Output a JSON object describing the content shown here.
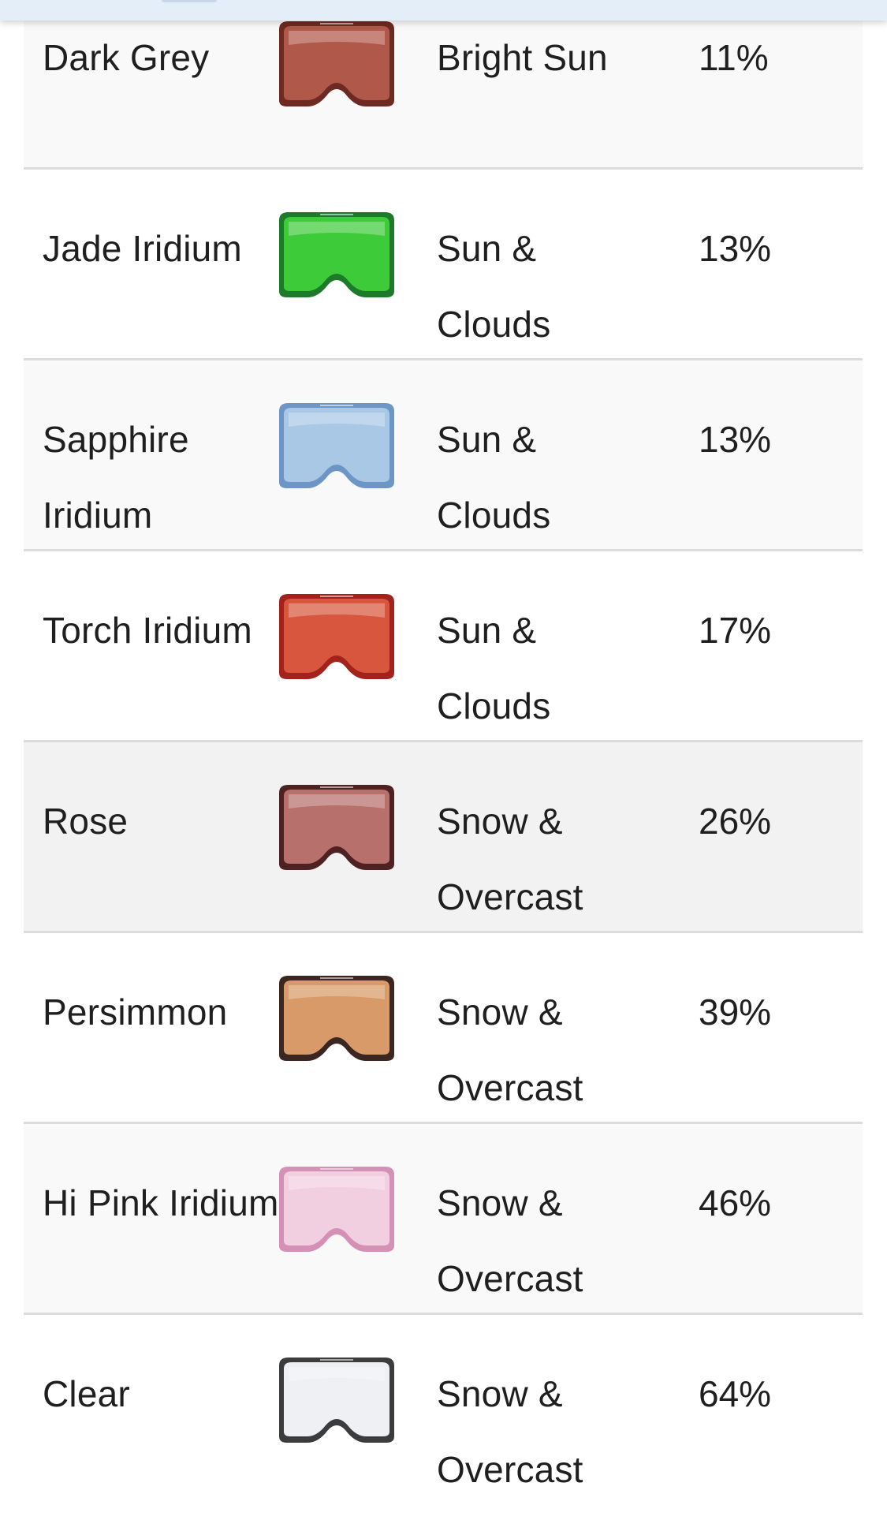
{
  "table": {
    "rows": [
      {
        "lens": "Dark Grey",
        "conditions": "Bright Sun",
        "vlt": "11%",
        "lens_color": "#b0584a",
        "frame_color": "#6d2a22",
        "style": "alt"
      },
      {
        "lens": "Jade Iridium",
        "conditions": "Sun & Clouds",
        "vlt": "13%",
        "lens_color": "#3ecb3a",
        "frame_color": "#1d7a2b",
        "style": "plain"
      },
      {
        "lens": "Sapphire Iridium",
        "conditions": "Sun & Clouds",
        "vlt": "13%",
        "lens_color": "#a9c8e6",
        "frame_color": "#6d95c6",
        "style": "alt"
      },
      {
        "lens": "Torch Iridium",
        "conditions": "Sun & Clouds",
        "vlt": "17%",
        "lens_color": "#d8563e",
        "frame_color": "#a3231c",
        "style": "plain"
      },
      {
        "lens": "Rose",
        "conditions": "Snow & Overcast",
        "vlt": "26%",
        "lens_color": "#b8706c",
        "frame_color": "#4e2222",
        "style": "highlight"
      },
      {
        "lens": "Persimmon",
        "conditions": "Snow & Overcast",
        "vlt": "39%",
        "lens_color": "#d89a68",
        "frame_color": "#3b2622",
        "style": "plain"
      },
      {
        "lens": "Hi Pink Iridium",
        "conditions": "Snow & Overcast",
        "vlt": "46%",
        "lens_color": "#f2cfe0",
        "frame_color": "#d590b6",
        "style": "alt"
      },
      {
        "lens": "Clear",
        "conditions": "Snow & Overcast",
        "vlt": "64%",
        "lens_color": "#eef0f4",
        "frame_color": "#3c3c3e",
        "style": "plain"
      }
    ]
  }
}
